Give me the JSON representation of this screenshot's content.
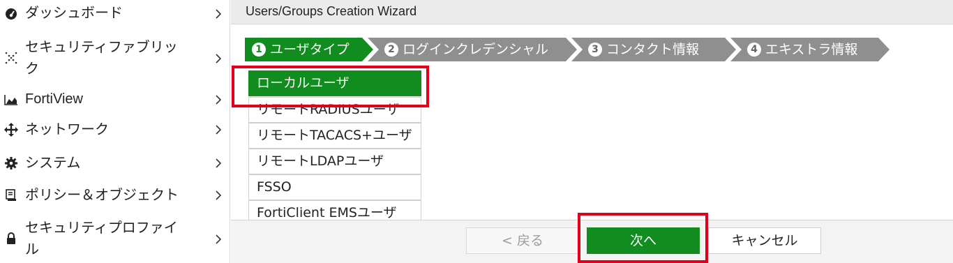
{
  "sidebar": {
    "items": [
      {
        "label": "ダッシュボード",
        "icon": "dashboard-icon"
      },
      {
        "label": "セキュリティファブリッ\nク",
        "icon": "security-fabric-icon"
      },
      {
        "label": "FortiView",
        "icon": "area-chart-icon"
      },
      {
        "label": "ネットワーク",
        "icon": "network-arrows-icon"
      },
      {
        "label": "システム",
        "icon": "gear-icon"
      },
      {
        "label": "ポリシー＆オブジェクト",
        "icon": "policy-icon"
      },
      {
        "label": "セキュリティプロファイ\nル",
        "icon": "lock-icon"
      }
    ]
  },
  "wizard": {
    "title": "Users/Groups Creation Wizard",
    "steps": [
      {
        "num": "1",
        "label": "ユーザタイプ",
        "active": true
      },
      {
        "num": "2",
        "label": "ログインクレデンシャル",
        "active": false
      },
      {
        "num": "3",
        "label": "コンタクト情報",
        "active": false
      },
      {
        "num": "4",
        "label": "エキストラ情報",
        "active": false
      }
    ],
    "user_types": [
      {
        "label": "ローカルユーザ",
        "selected": true
      },
      {
        "label": "リモートRADIUSユーザ",
        "selected": false
      },
      {
        "label": "リモートTACACS+ユーザ",
        "selected": false
      },
      {
        "label": "リモートLDAPユーザ",
        "selected": false
      },
      {
        "label": "FSSO",
        "selected": false
      },
      {
        "label": "FortiClient EMSユーザ",
        "selected": false
      }
    ]
  },
  "footer": {
    "back_label": "< 戻る",
    "next_label": "次へ",
    "cancel_label": "キャンセル"
  },
  "colors": {
    "accent_green": "#118d20",
    "step_inactive": "#8f8f8f",
    "highlight_red": "#e0001b"
  }
}
